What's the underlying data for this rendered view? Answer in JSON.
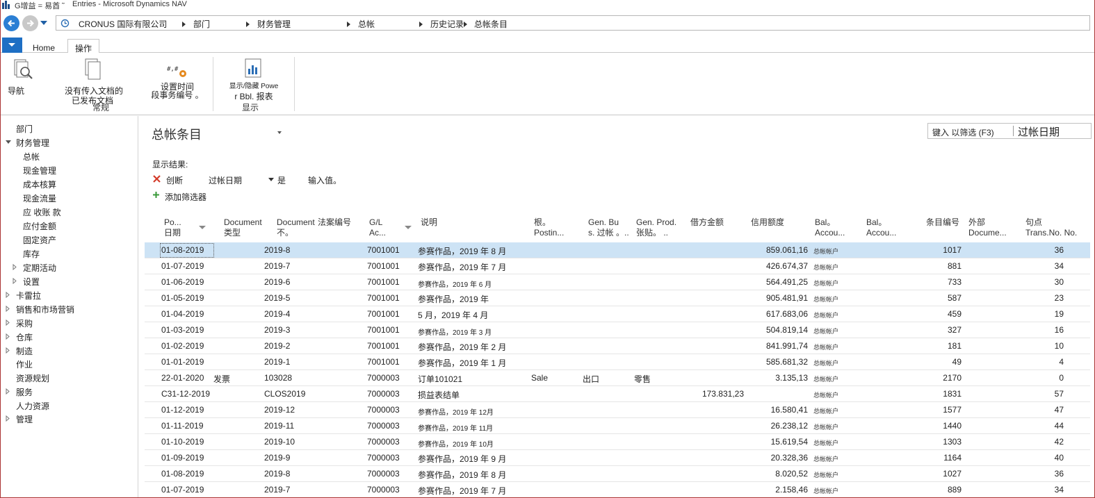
{
  "window": {
    "quick_access": "G增益 = 易酋 ˜",
    "title": "Entries - Microsoft Dynamics NAV"
  },
  "address": {
    "crumbs": [
      "CRONUS 国际有限公司",
      "部门",
      "财务管理",
      "总帐",
      "历史记录",
      "总帐条目"
    ]
  },
  "ribbon": {
    "tabs": {
      "home": "Home",
      "actions": "操作"
    },
    "buttons": {
      "navigate": "导航",
      "no_docs_line1": "没有传入文档的",
      "no_docs_line2": "已发布文档",
      "set_time_line1": "设置时间",
      "set_time_line2": "段事务编号 。",
      "powerbi_line1": "显示/隐藏 Powe",
      "powerbi_line2": "r Bbl. 报表"
    },
    "groups": {
      "general": "常规",
      "show": "显示"
    }
  },
  "sidebar": {
    "items": [
      {
        "label": "部门",
        "level": 0,
        "expander": "none"
      },
      {
        "label": "财务管理",
        "level": 0,
        "expander": "open"
      },
      {
        "label": "总帐",
        "level": 1,
        "expander": "none"
      },
      {
        "label": "现金管理",
        "level": 1,
        "expander": "none"
      },
      {
        "label": "成本核算",
        "level": 1,
        "expander": "none"
      },
      {
        "label": "现金流量",
        "level": 1,
        "expander": "none"
      },
      {
        "label": "应 收账 款",
        "level": 1,
        "expander": "none"
      },
      {
        "label": "应付金额",
        "level": 1,
        "expander": "none"
      },
      {
        "label": "固定资产",
        "level": 1,
        "expander": "none"
      },
      {
        "label": "库存",
        "level": 1,
        "expander": "none"
      },
      {
        "label": "定期活动",
        "level": 1,
        "expander": "closed"
      },
      {
        "label": "设置",
        "level": 1,
        "expander": "closed"
      },
      {
        "label": "卡雷拉",
        "level": 0,
        "expander": "closed"
      },
      {
        "label": "销售和市场营销",
        "level": 0,
        "expander": "closed"
      },
      {
        "label": "采购",
        "level": 0,
        "expander": "closed"
      },
      {
        "label": "仓库",
        "level": 0,
        "expander": "closed"
      },
      {
        "label": "制造",
        "level": 0,
        "expander": "closed"
      },
      {
        "label": "作业",
        "level": 0,
        "expander": "none"
      },
      {
        "label": "资源规划",
        "level": 0,
        "expander": "none"
      },
      {
        "label": "服务",
        "level": 0,
        "expander": "closed"
      },
      {
        "label": "人力资源",
        "level": 0,
        "expander": "none"
      },
      {
        "label": "管理",
        "level": 0,
        "expander": "closed"
      }
    ]
  },
  "main": {
    "title": "总帐条目",
    "filter_placeholder": "键入 以筛选 (F3)",
    "filter_field": "过帐日期",
    "show_results": "显示结果:",
    "filter_where": "创断",
    "filter_field_name": "过帐日期",
    "filter_is": "是",
    "filter_value": "输入值。",
    "add_filter": "添加筛选器"
  },
  "columns": [
    {
      "l1": "Po...",
      "l2": "日期"
    },
    {
      "l1": "Document",
      "l2": "类型"
    },
    {
      "l1": "Document",
      "l2": "不。"
    },
    {
      "l1": "法案编号",
      "l2": ""
    },
    {
      "l1": "G/L",
      "l2": "Ac..."
    },
    {
      "l1": "说明",
      "l2": ""
    },
    {
      "l1": "根。",
      "l2": "Postin..."
    },
    {
      "l1": "Gen. Bu",
      "l2": "s. 过帐 。.."
    },
    {
      "l1": "Gen. Prod.",
      "l2": "张贴。  .."
    },
    {
      "l1": "借方金额",
      "l2": ""
    },
    {
      "l1": "信用额度",
      "l2": ""
    },
    {
      "l1": "Bal。",
      "l2": "Accou..."
    },
    {
      "l1": "Bal。",
      "l2": "Accou..."
    },
    {
      "l1": "条目编号",
      "l2": ""
    },
    {
      "l1": "外部",
      "l2": "Docume..."
    },
    {
      "l1": "句点",
      "l2": "Trans.No. No."
    }
  ],
  "rows": [
    {
      "date": "01-08-2019",
      "doctype": "",
      "docno": "2019-8",
      "gl": "7001001",
      "desc": "参赛作品，2019 年 8 月",
      "gpt": "",
      "gbpg": "",
      "gppg": "",
      "debit": "",
      "credit": "859.061,16",
      "balacct": "总帐帐户",
      "entry": "1017",
      "trans": "36",
      "selected": true
    },
    {
      "date": "01-07-2019",
      "doctype": "",
      "docno": "2019-7",
      "gl": "7001001",
      "desc": "参赛作品，2019 年 7 月",
      "gpt": "",
      "gbpg": "",
      "gppg": "",
      "debit": "",
      "credit": "426.674,37",
      "balacct": "总帐帐户",
      "entry": "881",
      "trans": "34"
    },
    {
      "date": "01-06-2019",
      "doctype": "",
      "docno": "2019-6",
      "gl": "7001001",
      "desc": "参赛作品，2019 年 6 月",
      "gpt": "",
      "gbpg": "",
      "gppg": "",
      "debit": "",
      "credit": "564.491,25",
      "balacct": "总帐帐户",
      "entry": "733",
      "trans": "30",
      "small": true
    },
    {
      "date": "01-05-2019",
      "doctype": "",
      "docno": "2019-5",
      "gl": "7001001",
      "desc": "参赛作品，2019 年",
      "gpt": "",
      "gbpg": "",
      "gppg": "",
      "debit": "",
      "credit": "905.481,91",
      "balacct": "总帐帐户",
      "entry": "587",
      "trans": "23"
    },
    {
      "date": "01-04-2019",
      "doctype": "",
      "docno": "2019-4",
      "gl": "7001001",
      "desc": "5 月，2019 年 4 月",
      "gpt": "",
      "gbpg": "",
      "gppg": "",
      "debit": "",
      "credit": "617.683,06",
      "balacct": "总帐帐户",
      "entry": "459",
      "trans": "19"
    },
    {
      "date": "01-03-2019",
      "doctype": "",
      "docno": "2019-3",
      "gl": "7001001",
      "desc": "参赛作品，2019 年 3 月",
      "gpt": "",
      "gbpg": "",
      "gppg": "",
      "debit": "",
      "credit": "504.819,14",
      "balacct": "总帐帐户",
      "entry": "327",
      "trans": "16",
      "small": true
    },
    {
      "date": "01-02-2019",
      "doctype": "",
      "docno": "2019-2",
      "gl": "7001001",
      "desc": "参赛作品，2019 年 2 月",
      "gpt": "",
      "gbpg": "",
      "gppg": "",
      "debit": "",
      "credit": "841.991,74",
      "balacct": "总帐帐户",
      "entry": "181",
      "trans": "10"
    },
    {
      "date": "01-01-2019",
      "doctype": "",
      "docno": "2019-1",
      "gl": "7001001",
      "desc": "参赛作品，2019 年 1 月",
      "gpt": "",
      "gbpg": "",
      "gppg": "",
      "debit": "",
      "credit": "585.681,32",
      "balacct": "总帐帐户",
      "entry": "49",
      "trans": "4"
    },
    {
      "date": "22-01-2020",
      "doctype": "发票",
      "docno": "103028",
      "gl": "7000003",
      "desc": "订单101021",
      "gpt": "Sale",
      "gbpg": "出口",
      "gppg": "零售",
      "debit": "",
      "credit": "3.135,13",
      "balacct": "总帐帐户",
      "entry": "2170",
      "trans": "0"
    },
    {
      "date": "C31-12-2019",
      "doctype": "",
      "docno": "CLOS2019",
      "gl": "7000003",
      "desc": "损益表结单",
      "gpt": "",
      "gbpg": "",
      "gppg": "",
      "debit": "173.831,23",
      "credit": "",
      "balacct": "总帐帐户",
      "entry": "1831",
      "trans": "57"
    },
    {
      "date": "01-12-2019",
      "doctype": "",
      "docno": "2019-12",
      "gl": "7000003",
      "desc": "参赛作品，2019 年  12月",
      "gpt": "",
      "gbpg": "",
      "gppg": "",
      "debit": "",
      "credit": "16.580,41",
      "balacct": "总帐帐户",
      "entry": "1577",
      "trans": "47",
      "small": true
    },
    {
      "date": "01-11-2019",
      "doctype": "",
      "docno": "2019-11",
      "gl": "7000003",
      "desc": "参赛作品，2019 年  11月",
      "gpt": "",
      "gbpg": "",
      "gppg": "",
      "debit": "",
      "credit": "26.238,12",
      "balacct": "总帐帐户",
      "entry": "1440",
      "trans": "44",
      "small": true
    },
    {
      "date": "01-10-2019",
      "doctype": "",
      "docno": "2019-10",
      "gl": "7000003",
      "desc": "参赛作品，2019 年  10月",
      "gpt": "",
      "gbpg": "",
      "gppg": "",
      "debit": "",
      "credit": "15.619,54",
      "balacct": "总帐帐户",
      "entry": "1303",
      "trans": "42",
      "small": true
    },
    {
      "date": "01-09-2019",
      "doctype": "",
      "docno": "2019-9",
      "gl": "7000003",
      "desc": "参赛作品，2019 年 9 月",
      "gpt": "",
      "gbpg": "",
      "gppg": "",
      "debit": "",
      "credit": "20.328,36",
      "balacct": "总帐帐户",
      "entry": "1164",
      "trans": "40"
    },
    {
      "date": "01-08-2019",
      "doctype": "",
      "docno": "2019-8",
      "gl": "7000003",
      "desc": "参赛作品，2019 年 8 月",
      "gpt": "",
      "gbpg": "",
      "gppg": "",
      "debit": "",
      "credit": "8.020,52",
      "balacct": "总帐帐户",
      "entry": "1027",
      "trans": "36"
    },
    {
      "date": "01-07-2019",
      "doctype": "",
      "docno": "2019-7",
      "gl": "7000003",
      "desc": "参赛作品，2019 年 7 月",
      "gpt": "",
      "gbpg": "",
      "gppg": "",
      "debit": "",
      "credit": "2.158,46",
      "balacct": "总帐帐户",
      "entry": "889",
      "trans": "34"
    }
  ]
}
